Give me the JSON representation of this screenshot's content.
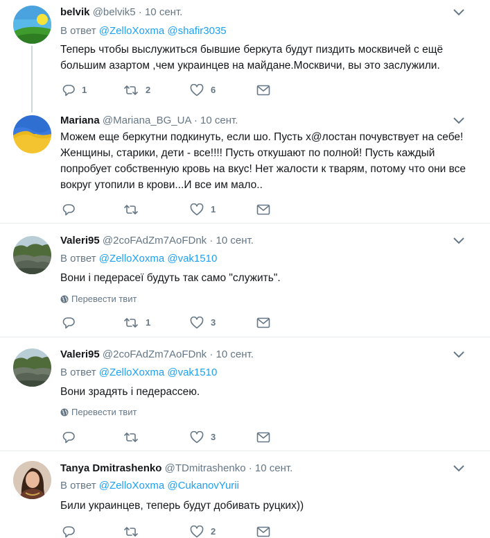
{
  "translate_label": "Перевести твит",
  "reply_prefix": "В ответ",
  "tweets": [
    {
      "name": "belvik",
      "handle": "@belvik5",
      "time": "10 сент.",
      "reply_to": [
        "@ZelloXoxma",
        "@shafir3035"
      ],
      "text": "Теперь чтобы выслужиться бывшие беркута будут пиздить москвичей с ещё большим азартом ,чем украинцев на майдане.Москвичи, вы это заслужили.",
      "replies": "1",
      "retweets": "2",
      "likes": "6",
      "avatar_icon": "landscape-avatar-icon"
    },
    {
      "name": "Mariana",
      "handle": "@Mariana_BG_UA",
      "time": "10 сент.",
      "text": "Можем еще беркутни подкинуть, если шо. Пусть х@лостан почувствует на себе! Женщины, старики, дети - все!!!! Пусть откушают по полной!  Пусть каждый попробует собственную кровь на вкус! Нет жалости к тварям, потому что они все вокруг утопили в крови...И все им мало..",
      "replies": "",
      "retweets": "",
      "likes": "1",
      "avatar_icon": "flag-avatar-icon"
    },
    {
      "name": "Valeri95",
      "handle": "@2coFAdZm7AoFDnk",
      "time": "10 сент.",
      "reply_to": [
        "@ZelloXoxma",
        "@vak1510"
      ],
      "text": "Вони і педерасеї  будуть так само \"служить\".",
      "replies": "",
      "retweets": "1",
      "likes": "3",
      "avatar_icon": "rocks-avatar-icon"
    },
    {
      "name": "Valeri95",
      "handle": "@2coFAdZm7AoFDnk",
      "time": "10 сент.",
      "reply_to": [
        "@ZelloXoxma",
        "@vak1510"
      ],
      "text": "Вони зрадять і педерассею.",
      "replies": "",
      "retweets": "",
      "likes": "3",
      "avatar_icon": "rocks-avatar-icon"
    },
    {
      "name": "Tanya Dmitrashenko",
      "handle": "@TDmitrashenko",
      "time": "10 сент.",
      "reply_to": [
        "@ZelloXoxma",
        "@CukanovYurii"
      ],
      "text": "Били украинцев, теперь будут добивать руцких))",
      "replies": "",
      "retweets": "",
      "likes": "2",
      "avatar_icon": "person-avatar-icon"
    }
  ]
}
